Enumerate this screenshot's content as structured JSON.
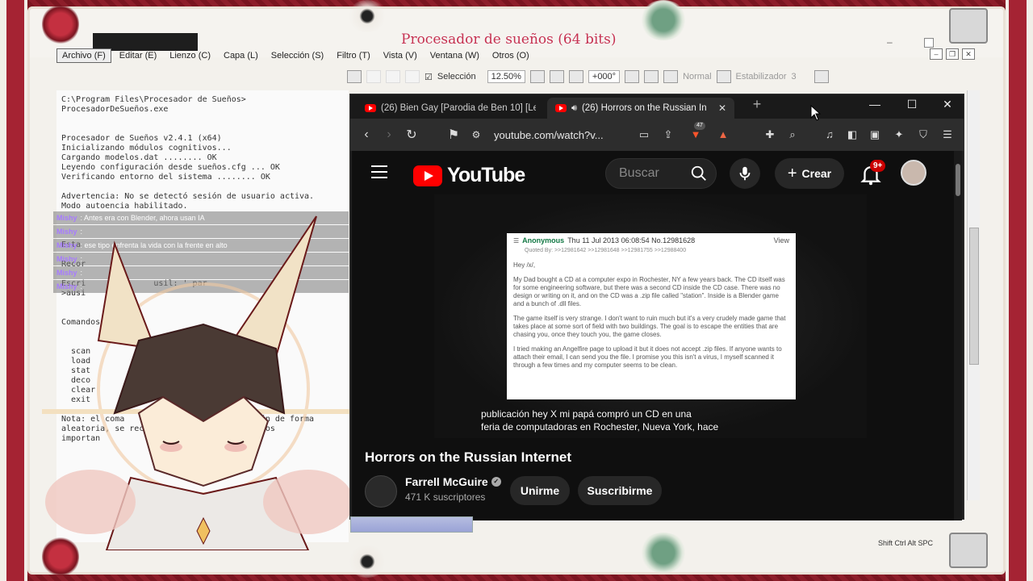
{
  "app": {
    "title": "Procesador de sueños (64 bits)",
    "menus": [
      "Archivo (F)",
      "Editar (E)",
      "Lienzo (C)",
      "Capa (L)",
      "Selección (S)",
      "Filtro (T)",
      "Vista (V)",
      "Ventana (W)",
      "Otros (O)"
    ],
    "toolbar": {
      "selection_label": "Selección",
      "zoom": "12.50%",
      "rotation": "+000°",
      "blend_mode": "Normal",
      "stabilizer_label": "Estabilizador",
      "stabilizer_value": "3"
    },
    "status": "Shift Ctrl Alt SPC"
  },
  "terminal": {
    "text": "C:\\Program Files\\Procesador de Sueños>\nProcesadorDeSueños.exe\n\n\nProcesador de Sueños v2.4.1 (x64)\nInicializando módulos cognitivos...\nCargando modelos.dat ........ OK\nLeyendo configuración desde sueños.cfg ... OK\nVerificando entorno del sistema ........ OK\n\nAdvertencia: No se detectó sesión de usuario activa.\nModo autoencia habilitado.\n\n\n\nEsta\n\nRecor\n\nEscri              usil: ' par\n>ausi\n\n\nComandos dispon\n\n\n  scan\n  load\n  stat\n  deco\n  clear\n  exit\n\nNota: el coma                         ación de forma\naleatoria, se recomi                   dados\nimportan"
  },
  "chat": [
    {
      "user": "Mishy",
      "message": ": Antes era con Blender, ahora usan IA"
    },
    {
      "user": "Mishy",
      "message": ":"
    },
    {
      "user": "Mishy",
      "message": ": ese tipo enfrenta la vida con la frente en alto"
    },
    {
      "user": "Mishy",
      "message": ":"
    },
    {
      "user": "Mishy",
      "message": ":"
    },
    {
      "user": "Mishy",
      "message": ":"
    }
  ],
  "browser": {
    "tabs": [
      {
        "title": "(26) Bien Gay [Parodia de Ben 10] [Le"
      },
      {
        "title": "(26) Horrors on the Russian In"
      }
    ],
    "new_tab": "+",
    "url": "youtube.com/watch?v...",
    "ext_badge": "47",
    "window_controls": {
      "minimize": "—",
      "maximize": "☐",
      "close": "✕"
    }
  },
  "youtube": {
    "logo_text": "YouTube",
    "search_placeholder": "Buscar",
    "create_label": "Crear",
    "notifications_badge": "9+",
    "post": {
      "author": "Anonymous",
      "meta": "Thu 11 Jul 2013 06:08:54 No.12981628",
      "view": "View",
      "quoted": "Quoted By: >>12981642 >>12981648 >>12981755 >>12988400",
      "greeting": "Hey /x/,",
      "p1": "My Dad bought a CD at a computer expo in Rochester, NY a few years back. The CD itself was for some engineering software, but there was a second CD inside the CD case. There was no design or writing on it, and on the CD was a .zip file called \"station\". Inside is a Blender game and a bunch of .dll files.",
      "p2": "The game itself is very strange. I don't want to ruin much but it's a very crudely made game that takes place at some sort of field with two buildings. The goal is to escape the entities that are chasing you, once they touch you, the game closes.",
      "p3": "I tried making an Angelfire page to upload it but it does not accept .zip files. If anyone wants to attach their email, I can send you the file. I promise you this isn't a virus, I myself scanned it through a few times and my computer seems to be clean."
    },
    "subtitle_line1": "publicación hey X mi papá compró un CD en una",
    "subtitle_line2": "feria de computadoras en Rochester, Nueva York, hace",
    "video_title": "Horrors on the Russian Internet",
    "channel_name": "Farrell McGuire",
    "channel_subs": "471 K suscriptores",
    "join_label": "Unirme",
    "subscribe_label": "Suscribirme"
  }
}
